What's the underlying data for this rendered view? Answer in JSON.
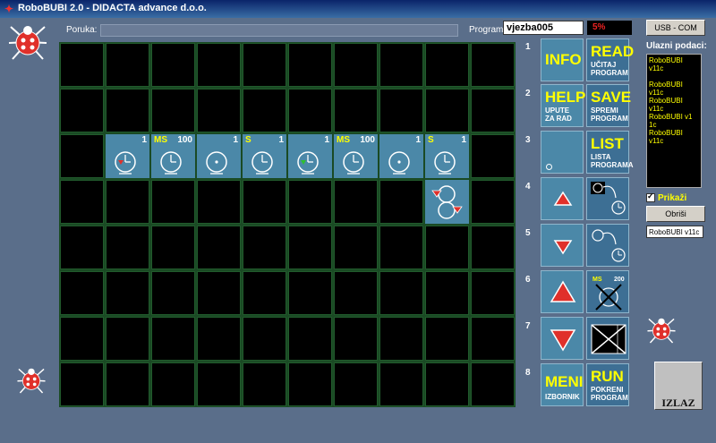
{
  "window": {
    "title": "RoboBUBI 2.0 - DIDACTA advance d.o.o."
  },
  "header": {
    "poruka_label": "Poruka:",
    "program_label": "Program:",
    "program_value": "vjezba005",
    "percent": "5%",
    "usb_label": "USB - COM"
  },
  "row_numbers": [
    "1",
    "2",
    "3",
    "4",
    "5",
    "6",
    "7",
    "8"
  ],
  "program_row": [
    {
      "unit": "",
      "count": "1",
      "icon": "clock-red-arrow-icon"
    },
    {
      "unit": "MS",
      "count": "100",
      "icon": "clock-icon"
    },
    {
      "unit": "",
      "count": "1",
      "icon": "clock-dot-icon"
    },
    {
      "unit": "S",
      "count": "1",
      "icon": "clock-icon"
    },
    {
      "unit": "",
      "count": "1",
      "icon": "clock-green-arrow-icon"
    },
    {
      "unit": "MS",
      "count": "100",
      "icon": "clock-icon"
    },
    {
      "unit": "",
      "count": "1",
      "icon": "clock-dot-icon"
    },
    {
      "unit": "S",
      "count": "1",
      "icon": "clock-icon"
    }
  ],
  "buttons": {
    "info": "INFO",
    "read": "READ",
    "read_sub1": "UČITAJ",
    "read_sub2": "PROGRAM",
    "help": "HELP",
    "help_sub1": "UPUTE",
    "help_sub2": "ZA RAD",
    "save": "SAVE",
    "save_sub1": "SPREMI",
    "save_sub2": "PROGRAM",
    "list": "LIST",
    "list_sub1": "LISTA",
    "list_sub2": "PROGRAMA",
    "meni": "MENI",
    "meni_sub": "IZBORNIK",
    "run": "RUN",
    "run_sub1": "POKRENI",
    "run_sub2": "PROGRAM",
    "timer_unit": "MS",
    "timer_value": "200"
  },
  "side": {
    "ulazni_label": "Ulazni podaci:",
    "ulazni_lines": [
      "RoboBUBI v11c",
      "",
      "RoboBUBI",
      "v11c",
      "RoboBUBI v11c",
      "RoboBUBI v1",
      "1c",
      "RoboBUBI v11c"
    ],
    "prikazi_label": "Prikaži",
    "obrisi_label": "Obriši",
    "last_value": "RoboBUBI v11c",
    "izlaz_label": "IZLAZ"
  }
}
